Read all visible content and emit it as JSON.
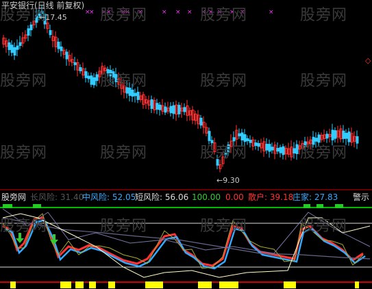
{
  "header": {
    "title": "平安银行(日线 前复权)",
    "color": "#cccccc"
  },
  "price_panel": {
    "high_label": "17.45",
    "low_label": "9.30",
    "arrow": "←",
    "up_color": "#ff3333",
    "down_color": "#33ccff",
    "marker_color": "#ff33ff"
  },
  "indicator": {
    "name": "股旁网",
    "items": [
      {
        "label": "长风险:",
        "value": "31.40",
        "color": "#555555"
      },
      {
        "label": "中风险:",
        "value": "52.05",
        "color": "#33aaff"
      },
      {
        "label": "短风险:",
        "value": "56.06",
        "color": "#dddddd"
      },
      {
        "label": "",
        "value": "100.00",
        "color": "#33cc33"
      },
      {
        "label": "",
        "value": "0.00",
        "color": "#ff3333"
      },
      {
        "label": "散户:",
        "value": "39.18",
        "color": "#ff3333"
      },
      {
        "label": "庄家:",
        "value": "27.83",
        "color": "#33aaff"
      }
    ],
    "warn_label": "警示"
  },
  "watermark": "股旁网",
  "right_marker": "◇",
  "chart_data": {
    "type": "candlestick",
    "title": "平安银行(日线 前复权)",
    "annotations": [
      {
        "text": "17.45",
        "kind": "high"
      },
      {
        "text": "9.30",
        "kind": "low"
      }
    ],
    "indicator_values": {
      "长风险": 31.4,
      "中风险": 52.05,
      "短风险": 56.06,
      "upper": 100.0,
      "lower": 0.0,
      "散户": 39.18,
      "庄家": 27.83
    }
  }
}
